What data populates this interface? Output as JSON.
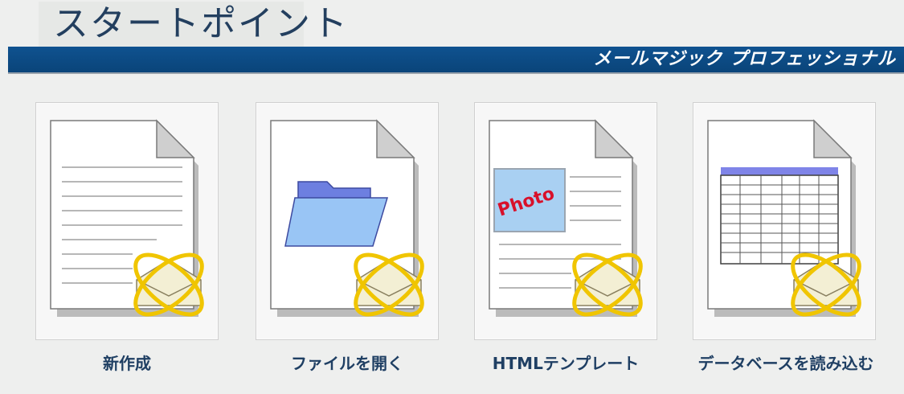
{
  "header": {
    "title": "スタートポイント",
    "subtitle": "メールマジック プロフェッショナル"
  },
  "colors": {
    "banner": "#0a4d8c",
    "title_text": "#233f5f",
    "label_text": "#1f3f63",
    "folder": "#8fbaf2",
    "table_header": "#7f84e8",
    "photo_bg": "#a9d0f2",
    "photo_text": "#d8102a",
    "envelope_ring": "#f1c800"
  },
  "cards": [
    {
      "label": "新作成",
      "icon": "new-document-icon"
    },
    {
      "label": "ファイルを開く",
      "icon": "open-folder-icon"
    },
    {
      "label": "HTMLテンプレート",
      "icon": "html-template-icon",
      "photo_text": "Photo"
    },
    {
      "label": "データベースを読み込む",
      "icon": "database-table-icon"
    }
  ]
}
